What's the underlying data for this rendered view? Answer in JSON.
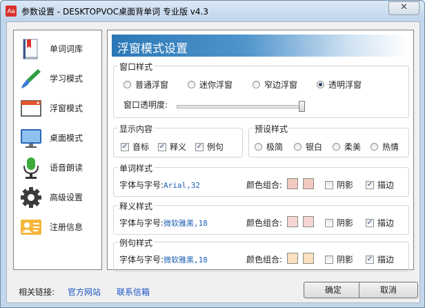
{
  "window": {
    "title": "参数设置 - DESKTOPVOC桌面背单词 专业版 v4.3",
    "app_icon_text": "Aa",
    "close_label": "✕"
  },
  "sidebar": {
    "items": [
      {
        "label": "单词词库",
        "icon": "book-icon"
      },
      {
        "label": "学习模式",
        "icon": "brush-icon"
      },
      {
        "label": "浮窗模式",
        "icon": "window-icon"
      },
      {
        "label": "桌面模式",
        "icon": "monitor-icon"
      },
      {
        "label": "语音朗读",
        "icon": "microphone-icon"
      },
      {
        "label": "高级设置",
        "icon": "gear-icon"
      },
      {
        "label": "注册信息",
        "icon": "id-card-icon"
      }
    ]
  },
  "main": {
    "header": "浮窗模式设置",
    "window_style": {
      "title": "窗口样式",
      "options": [
        "普通浮窗",
        "迷你浮窗",
        "窄边浮窗",
        "透明浮窗"
      ],
      "selected": "透明浮窗",
      "opacity_label": "窗口透明度:",
      "opacity_level": 1.0
    },
    "display": {
      "title": "显示内容",
      "items": [
        {
          "label": "音标",
          "checked": true
        },
        {
          "label": "释义",
          "checked": true
        },
        {
          "label": "例句",
          "checked": true
        }
      ]
    },
    "preset": {
      "title": "预设样式",
      "options": [
        "极简",
        "银白",
        "柔美",
        "热情"
      ]
    },
    "sections": [
      {
        "title": "单词样式",
        "font_label": "字体与字号:",
        "font_value": "Arial,32",
        "color_label": "颜色组合:",
        "colors": [
          "#f2c9bf",
          "#f2c9bf"
        ],
        "shadow_label": "阴影",
        "shadow": false,
        "stroke_label": "描边",
        "stroke": true
      },
      {
        "title": "释义样式",
        "font_label": "字体与字号:",
        "font_value": "微软雅黑,18",
        "color_label": "颜色组合:",
        "colors": [
          "#f5d6d2",
          "#f5d6d2"
        ],
        "shadow_label": "阴影",
        "shadow": false,
        "stroke_label": "描边",
        "stroke": true
      },
      {
        "title": "例句样式",
        "font_label": "字体与字号:",
        "font_value": "微软雅黑,18",
        "color_label": "颜色组合:",
        "colors": [
          "#fbe0bf",
          "#fbe0bf"
        ],
        "shadow_label": "阴影",
        "shadow": false,
        "stroke_label": "描边",
        "stroke": true
      }
    ]
  },
  "footer": {
    "label": "相关链接:",
    "links": [
      "官方网站",
      "联系信箱"
    ],
    "ok": "确定",
    "cancel": "取消"
  }
}
